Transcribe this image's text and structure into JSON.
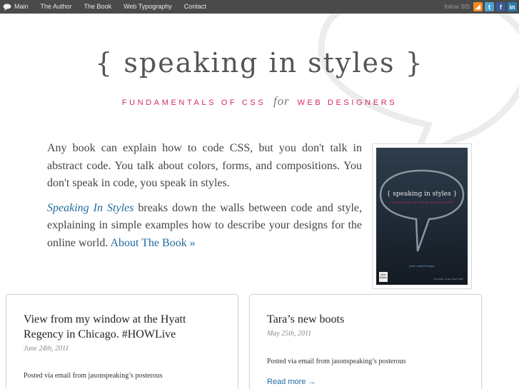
{
  "nav": {
    "items": [
      {
        "label": "Main"
      },
      {
        "label": "The Author"
      },
      {
        "label": "The Book"
      },
      {
        "label": "Web Typography"
      },
      {
        "label": "Contact"
      }
    ],
    "follow_label": "follow SIS",
    "social": [
      {
        "icon": "rss-icon",
        "glyph": "◢"
      },
      {
        "icon": "twitter-icon",
        "glyph": "t"
      },
      {
        "icon": "facebook-icon",
        "glyph": "f"
      },
      {
        "icon": "linkedin-icon",
        "glyph": "in"
      }
    ]
  },
  "header": {
    "title": "{ speaking in styles }",
    "subtitle_left": "FUNDAMENTALS OF CSS",
    "subtitle_for": "for",
    "subtitle_right": "WEB DESIGNERS"
  },
  "intro": {
    "paragraph1": "Any book can explain how to code CSS, but you don't talk in abstract code. You talk about colors, forms, and compositions. You don't speak in code, you speak in styles.",
    "book_name": "Speaking In Styles",
    "paragraph2_rest": " breaks down the walls between code and style, explaining in simple examples how to describe your designs for the online world. ",
    "about_link": "About The Book »"
  },
  "cover": {
    "title": "{ speaking in styles }",
    "subtitle": "FUNDAMENTALS OF CSS for WEB DESIGNERS",
    "author": "jason cranford teague",
    "publisher": "New Riders",
    "tagline": "VOICES THAT MATTER"
  },
  "posts": [
    {
      "title": "View from my window at the Hyatt Regency in Chicago. #HOWLive",
      "date": "June 24th, 2011",
      "excerpt": "Posted via email from jasonspeaking’s posterous"
    },
    {
      "title": "Tara’s new boots",
      "date": "May 25th, 2011",
      "excerpt": "Posted via email from jasonspeaking’s posterous",
      "more": "Read more →"
    }
  ],
  "colors": {
    "topbar": "#4a4a4a",
    "accent_pink": "#d4286e",
    "link_blue": "#1f6b9c"
  }
}
